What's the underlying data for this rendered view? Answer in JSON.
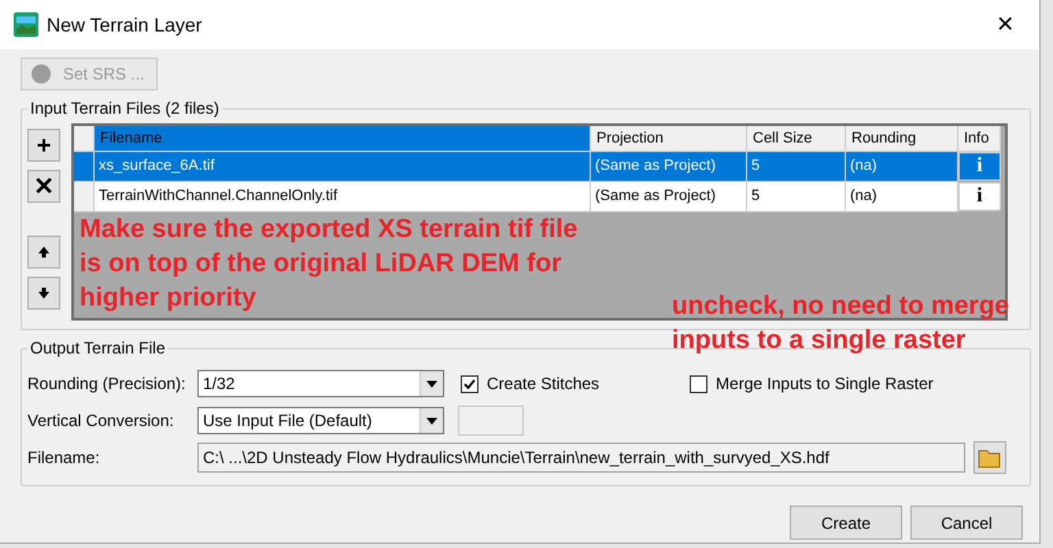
{
  "window": {
    "title": "New Terrain Layer",
    "close": "✕"
  },
  "set_srs_button": {
    "label": "Set SRS ...",
    "disabled": true
  },
  "input_group": {
    "title": "Input Terrain Files (2 files)",
    "side_buttons": [
      {
        "label": "+",
        "kind": "glyph"
      },
      {
        "label": "✕",
        "kind": "glyph"
      },
      {
        "kind": "up"
      },
      {
        "kind": "down"
      }
    ],
    "table": {
      "columns": [
        "Filename",
        "Projection",
        "Cell Size",
        "Rounding",
        "Info"
      ],
      "rows": [
        {
          "cells": [
            "xs_surface_6A.tif",
            "(Same as Project)",
            "5",
            "(na)",
            "i"
          ],
          "selected": true
        },
        {
          "cells": [
            "TerrainWithChannel.ChannelOnly.tif",
            "(Same as Project)",
            "5",
            "(na)",
            "i"
          ],
          "selected": false
        }
      ]
    }
  },
  "output_group": {
    "title": "Output Terrain File",
    "rounding": {
      "label": "Rounding (Precision):",
      "value": "1/32"
    },
    "create_stitches": {
      "label": "Create Stitches",
      "checked": true
    },
    "merge_inputs": {
      "label": "Merge Inputs to Single Raster",
      "checked": false
    },
    "vertical_conversion": {
      "label": "Vertical Conversion:",
      "value": "Use Input File (Default)"
    },
    "filename": {
      "label": "Filename:",
      "value": "C:\\ ...\\2D Unsteady Flow Hydraulics\\Muncie\\Terrain\\new_terrain_with_survyed_XS.hdf"
    }
  },
  "buttons": [
    "Create",
    "Cancel"
  ],
  "annotations": [
    {
      "text": "Make sure the exported XS terrain tif file is on top of the original LiDAR DEM for higher priority",
      "kind": "left"
    },
    {
      "text": "uncheck, no need to merge inputs to a single raster",
      "kind": "right"
    }
  ]
}
